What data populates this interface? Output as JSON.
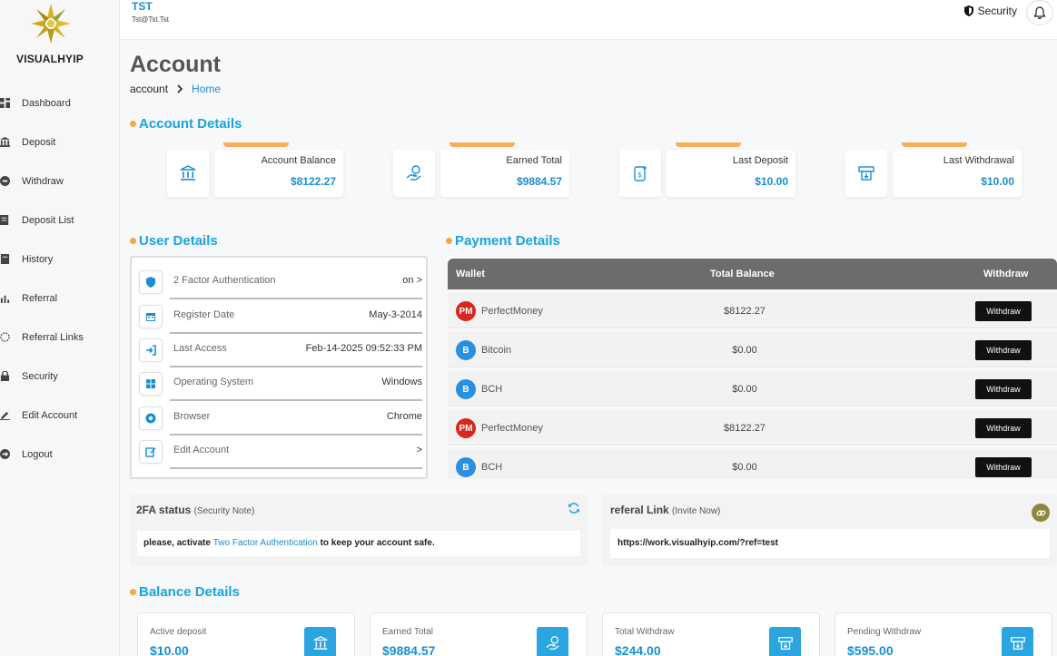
{
  "brand": {
    "name": "VISUALHYIP"
  },
  "sidebar": {
    "items": [
      {
        "label": "Dashboard",
        "icon": "dashboard-icon"
      },
      {
        "label": "Deposit",
        "icon": "bank-icon"
      },
      {
        "label": "Withdraw",
        "icon": "withdraw-icon"
      },
      {
        "label": "Deposit List",
        "icon": "list-icon"
      },
      {
        "label": "History",
        "icon": "history-icon"
      },
      {
        "label": "Referral",
        "icon": "chart-icon"
      },
      {
        "label": "Referral Links",
        "icon": "link-icon"
      },
      {
        "label": "Security",
        "icon": "lock-icon"
      },
      {
        "label": "Edit Account",
        "icon": "pencil-icon"
      },
      {
        "label": "Logout",
        "icon": "logout-icon"
      }
    ]
  },
  "header": {
    "user_name": "TST",
    "user_email": "Tst@Tst.Tst",
    "security_label": "Security"
  },
  "page": {
    "title": "Account",
    "breadcrumb": {
      "current": "account",
      "home": "Home"
    }
  },
  "account_details": {
    "title": "Account Details",
    "cards": [
      {
        "label": "Account Balance",
        "value": "$8122.27",
        "icon": "bank-icon"
      },
      {
        "label": "Earned Total",
        "value": "$9884.57",
        "icon": "hand-coin-icon"
      },
      {
        "label": "Last Deposit",
        "value": "$10.00",
        "icon": "deposit-icon"
      },
      {
        "label": "Last Withdrawal",
        "value": "$10.00",
        "icon": "atm-icon"
      }
    ]
  },
  "user_details": {
    "title": "User Details",
    "rows": [
      {
        "label": "2 Factor Authentication",
        "value": "on >",
        "icon": "shield-icon"
      },
      {
        "label": "Register Date",
        "value": "May-3-2014",
        "icon": "calendar-icon"
      },
      {
        "label": "Last Access",
        "value": "Feb-14-2025 09:52:33 PM",
        "icon": "login-icon"
      },
      {
        "label": "Operating System",
        "value": "Windows",
        "icon": "windows-icon"
      },
      {
        "label": "Browser",
        "value": "Chrome",
        "icon": "browser-icon"
      },
      {
        "label": "Edit Account",
        "value": ">",
        "icon": "edit-icon"
      }
    ]
  },
  "payment_details": {
    "title": "Payment Details",
    "columns": {
      "wallet": "Wallet",
      "balance": "Total Balance",
      "withdraw": "Withdraw"
    },
    "rows": [
      {
        "wallet": "PerfectMoney",
        "logo": "PM",
        "logo_color": "#d6281e",
        "balance": "$8122.27",
        "button": "Withdraw"
      },
      {
        "wallet": "Bitcoin",
        "logo": "B",
        "logo_color": "#2b8fe0",
        "balance": "$0.00",
        "button": "Withdraw"
      },
      {
        "wallet": "BCH",
        "logo": "B",
        "logo_color": "#2b8fe0",
        "balance": "$0.00",
        "button": "Withdraw"
      },
      {
        "wallet": "PerfectMoney",
        "logo": "PM",
        "logo_color": "#d6281e",
        "balance": "$8122.27",
        "button": "Withdraw"
      },
      {
        "wallet": "BCH",
        "logo": "B",
        "logo_color": "#2b8fe0",
        "balance": "$0.00",
        "button": "Withdraw"
      }
    ]
  },
  "twofa": {
    "title": "2FA status",
    "subtitle": "(Security Note)",
    "msg_before": "please, activate",
    "msg_link": "Two Factor Authentication",
    "msg_after": "to keep your account safe."
  },
  "referral": {
    "title": "referal Link",
    "subtitle": "(Invite Now)",
    "url": "https://work.visualhyip.com/?ref=test"
  },
  "balance_details": {
    "title": "Balance Details",
    "cards": [
      {
        "label": "Active deposit",
        "value": "$10.00",
        "icon": "bank-icon"
      },
      {
        "label": "Earned Total",
        "value": "$9884.57",
        "icon": "hand-coin-icon"
      },
      {
        "label": "Total Withdraw",
        "value": "$244.00",
        "icon": "atm-icon"
      },
      {
        "label": "Pending Withdraw",
        "value": "$595.00",
        "icon": "atm-icon"
      }
    ]
  },
  "colors": {
    "accent": "#1aa3e0",
    "link": "#1a8ed0",
    "dot": "#f7a541",
    "stripe": "#f7b05a"
  }
}
